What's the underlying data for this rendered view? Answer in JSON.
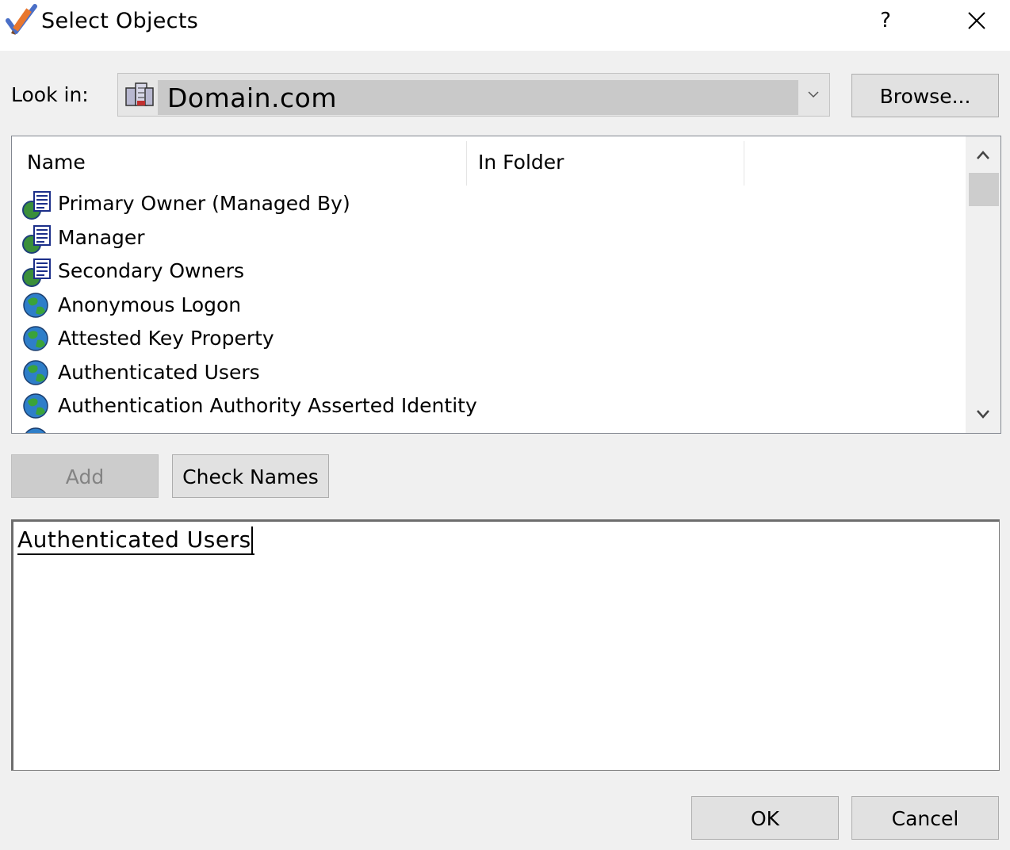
{
  "window": {
    "title": "Select Objects",
    "help_label": "?",
    "icons": {
      "app": "checkmark-pencil-icon",
      "close": "close-icon"
    }
  },
  "lookin": {
    "label": "Look in:",
    "value": "Domain.com",
    "icon": "domain-icon",
    "browse_label": "Browse..."
  },
  "list": {
    "columns": [
      "Name",
      "In Folder"
    ],
    "rows": [
      {
        "name": "Primary Owner (Managed By)",
        "icon": "group-object-icon"
      },
      {
        "name": "Manager",
        "icon": "group-object-icon"
      },
      {
        "name": "Secondary Owners",
        "icon": "group-object-icon"
      },
      {
        "name": "Anonymous Logon",
        "icon": "globe-icon"
      },
      {
        "name": "Attested Key Property",
        "icon": "globe-icon"
      },
      {
        "name": "Authenticated Users",
        "icon": "globe-icon"
      },
      {
        "name": "Authentication Authority Asserted Identity",
        "icon": "globe-icon"
      }
    ]
  },
  "actions": {
    "add_label": "Add",
    "check_names_label": "Check Names"
  },
  "names_box": {
    "value": "Authenticated Users"
  },
  "footer": {
    "ok_label": "OK",
    "cancel_label": "Cancel"
  },
  "colors": {
    "window_bg": "#f0f0f0",
    "button_bg": "#e1e1e1",
    "disabled_button_bg": "#cccccc",
    "combo_bg": "#e6e6e6",
    "combo_selection": "#c9c9c9"
  }
}
